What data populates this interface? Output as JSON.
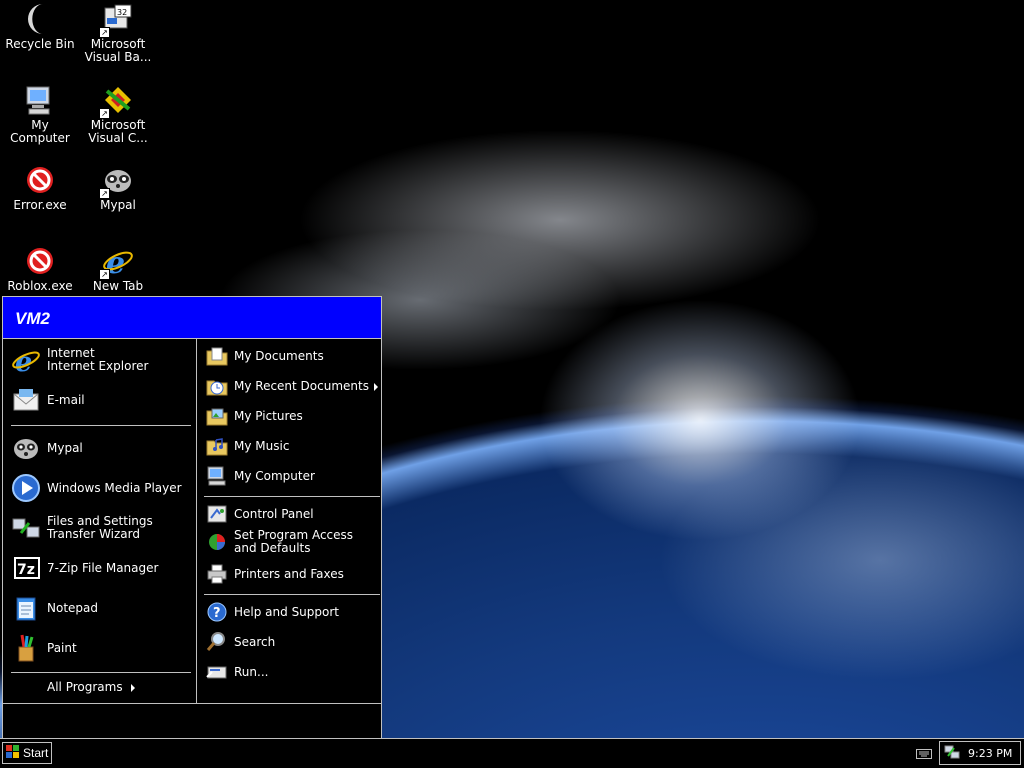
{
  "desktop": {
    "icons": [
      {
        "label": "Recycle Bin",
        "icon": "moon-recycle-bin-icon"
      },
      {
        "label": "Microsoft Visual Ba...",
        "icon": "visual-basic-icon"
      },
      {
        "label": "My Computer",
        "icon": "computer-icon"
      },
      {
        "label": "Microsoft Visual C...",
        "icon": "visual-c-icon"
      },
      {
        "label": "Error.exe",
        "icon": "error-icon"
      },
      {
        "label": "Mypal",
        "icon": "mypal-icon"
      },
      {
        "label": "Roblox.exe",
        "icon": "error-icon"
      },
      {
        "label": "New Tab",
        "icon": "internet-explorer-icon"
      }
    ]
  },
  "start_menu": {
    "title": "VM2",
    "left": {
      "pinned": [
        {
          "line1": "Internet",
          "line2": "Internet Explorer"
        },
        {
          "line1": "E-mail"
        }
      ],
      "recent": [
        {
          "line1": "Mypal"
        },
        {
          "line1": "Windows Media Player"
        },
        {
          "line1": "Files and Settings",
          "line2": "Transfer Wizard"
        },
        {
          "line1": "7-Zip File Manager"
        },
        {
          "line1": "Notepad"
        },
        {
          "line1": "Paint"
        }
      ],
      "all_programs": "All Programs"
    },
    "right": {
      "places": [
        {
          "label": "My Documents"
        },
        {
          "label": "My Recent Documents"
        },
        {
          "label": "My Pictures"
        },
        {
          "label": "My Music"
        },
        {
          "label": "My Computer"
        }
      ],
      "settings": [
        {
          "label": "Control Panel"
        },
        {
          "line1": "Set Program Access",
          "line2": "and Defaults"
        },
        {
          "label": "Printers and Faxes"
        }
      ],
      "tools": [
        {
          "label": "Help and Support"
        },
        {
          "label": "Search"
        },
        {
          "label": "Run..."
        }
      ]
    }
  },
  "taskbar": {
    "start_label": "Start",
    "clock": "9:23 PM"
  },
  "colors": {
    "menu_header": "#0000ff",
    "menu_bg": "#000000",
    "border": "#c0c0c0"
  }
}
